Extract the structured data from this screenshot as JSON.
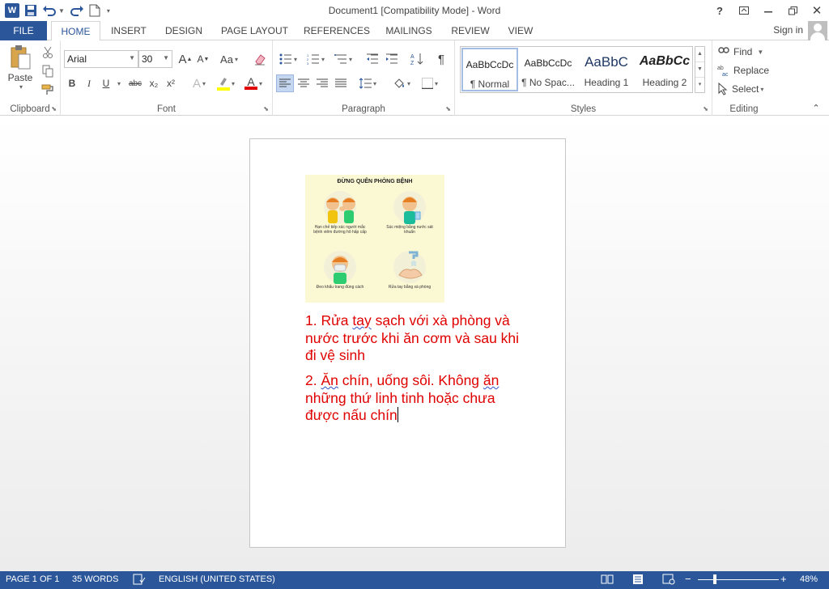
{
  "titlebar": {
    "title": "Document1 [Compatibility Mode] - Word",
    "help": "?",
    "buttons": [
      "help",
      "ribbon-display",
      "minimize",
      "restore",
      "close"
    ]
  },
  "tabs": {
    "file": "FILE",
    "items": [
      "HOME",
      "INSERT",
      "DESIGN",
      "PAGE LAYOUT",
      "REFERENCES",
      "MAILINGS",
      "REVIEW",
      "VIEW"
    ],
    "active": "HOME",
    "signin": "Sign in"
  },
  "clipboard": {
    "label": "Clipboard",
    "paste": "Paste"
  },
  "font": {
    "label": "Font",
    "family": "Arial",
    "size": "30",
    "bold": "B",
    "italic": "I",
    "underline": "U",
    "strike": "abc",
    "subscript": "x₂",
    "superscript": "x²",
    "case": "Aa",
    "grow": "A",
    "shrink": "A",
    "effects": "A",
    "color": "A",
    "highlight_color": "#ffff00",
    "font_color": "#e00000"
  },
  "paragraph": {
    "label": "Paragraph"
  },
  "styles": {
    "label": "Styles",
    "items": [
      {
        "sample": "AaBbCcDc",
        "name": "¶ Normal"
      },
      {
        "sample": "AaBbCcDc",
        "name": "¶ No Spac..."
      },
      {
        "sample": "AaBbC",
        "name": "Heading 1"
      },
      {
        "sample": "AaBbCc",
        "name": "Heading 2"
      }
    ]
  },
  "editing": {
    "label": "Editing",
    "find": "Find",
    "replace": "Replace",
    "select": "Select"
  },
  "document": {
    "figure_title": "ĐỪNG QUÊN PHÒNG BỆNH",
    "figure_captions": [
      "Hạn chế tiếp xúc người mắc bệnh viêm đường hô hấp cấp",
      "Súc miệng bằng nước sát khuẩn",
      "Đeo khẩu trang đúng cách",
      "Rửa tay bằng xà phòng"
    ],
    "para1_a": "1. Rửa ",
    "para1_b": "tay",
    "para1_c": " sạch với xà phòng và nước trước khi ăn cơm và sau khi đi vệ sinh",
    "para2_a": "2. ",
    "para2_b": "Ăn",
    "para2_c": " chín, uống sôi. Không ",
    "para2_d": "ăn",
    "para2_e": " những thứ linh tinh hoặc chưa được nấu chín",
    "text_color": "#e00000"
  },
  "statusbar": {
    "page": "PAGE 1 OF 1",
    "words": "35 WORDS",
    "language": "ENGLISH (UNITED STATES)",
    "zoom": "48%",
    "zoom_minus": "−",
    "zoom_plus": "+",
    "zoom_level_percent": 48
  },
  "colors": {
    "brand": "#2b579a",
    "status_bg": "#2b579a"
  }
}
